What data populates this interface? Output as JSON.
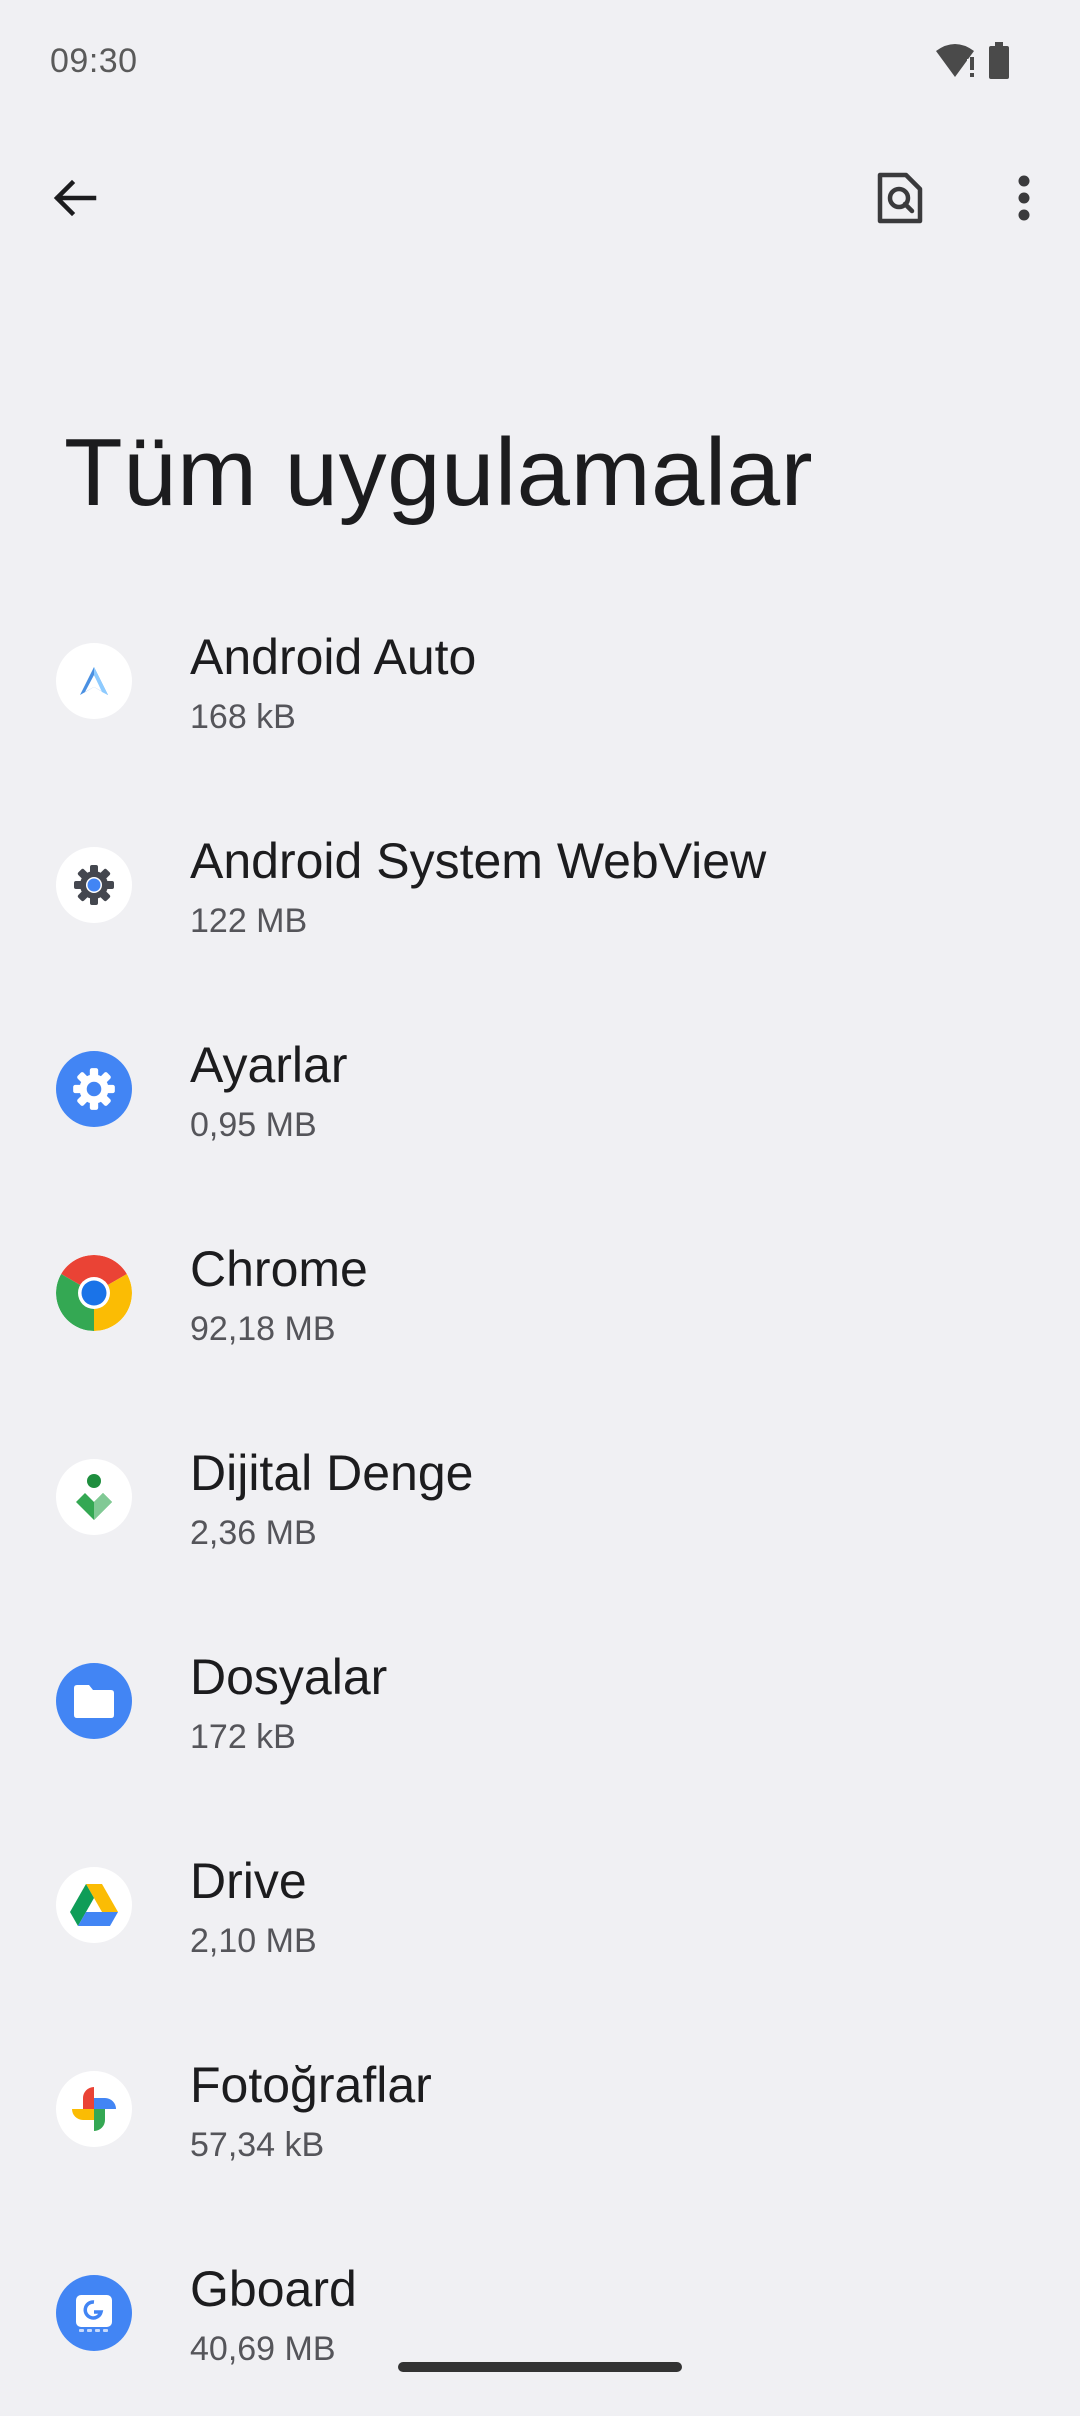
{
  "status_bar": {
    "time": "09:30",
    "icons": [
      "wifi-alert-icon",
      "battery-icon"
    ]
  },
  "toolbar": {
    "back_icon": "arrow-back-icon",
    "search_icon": "search-document-icon",
    "more_icon": "more-vertical-icon"
  },
  "page": {
    "title": "Tüm uygulamalar"
  },
  "apps": [
    {
      "name": "Android Auto",
      "size": "168 kB",
      "icon": "android-auto-icon"
    },
    {
      "name": "Android System WebView",
      "size": "122 MB",
      "icon": "webview-gear-icon"
    },
    {
      "name": "Ayarlar",
      "size": "0,95 MB",
      "icon": "settings-gear-icon"
    },
    {
      "name": "Chrome",
      "size": "92,18 MB",
      "icon": "chrome-icon"
    },
    {
      "name": "Dijital Denge",
      "size": "2,36 MB",
      "icon": "digital-wellbeing-icon"
    },
    {
      "name": "Dosyalar",
      "size": "172 kB",
      "icon": "files-folder-icon"
    },
    {
      "name": "Drive",
      "size": "2,10 MB",
      "icon": "drive-icon"
    },
    {
      "name": "Fotoğraflar",
      "size": "57,34 kB",
      "icon": "photos-pinwheel-icon"
    },
    {
      "name": "Gboard",
      "size": "40,69 MB",
      "icon": "gboard-icon"
    }
  ],
  "colors": {
    "background": "#f0f0f3",
    "google_blue": "#4285f4",
    "google_red": "#ea4335",
    "google_yellow": "#fbbc04",
    "google_green": "#34a853"
  }
}
